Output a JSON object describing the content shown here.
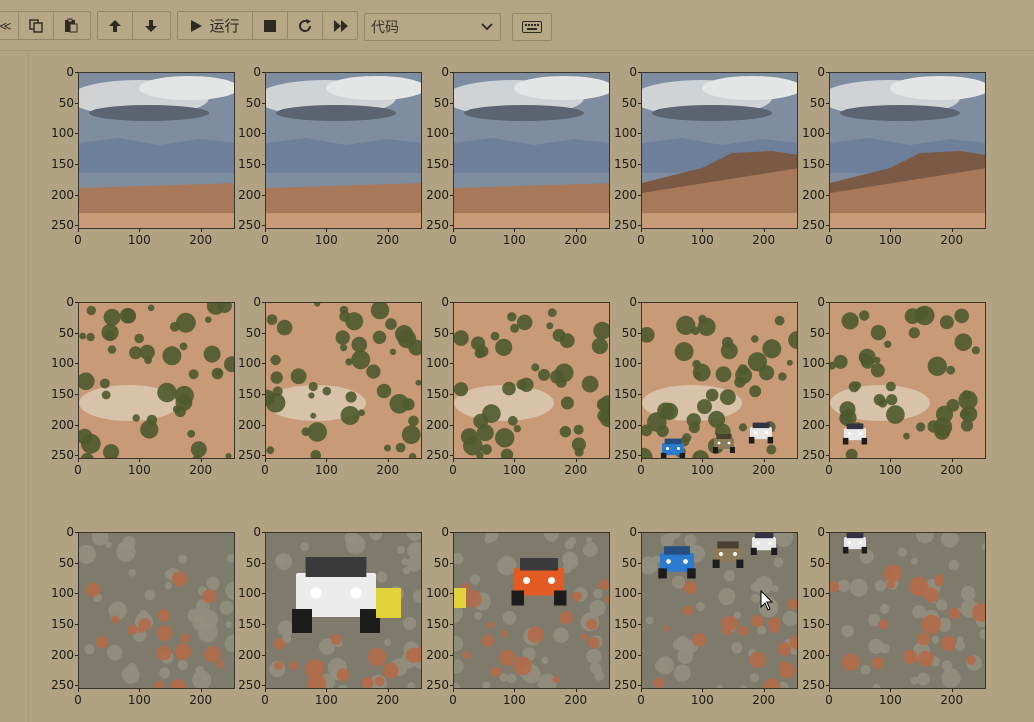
{
  "toolbar": {
    "partial_left": "≪",
    "copy_icon": "copy-icon",
    "paste_icon": "paste-icon",
    "up_icon": "arrow-up-icon",
    "down_icon": "arrow-down-icon",
    "run_label": "运行",
    "stop_icon": "stop-icon",
    "restart_icon": "restart-icon",
    "fast_forward_icon": "fast-forward-icon",
    "cell_type_value": "代码",
    "keyboard_icon": "keyboard-icon"
  },
  "grid": {
    "rows": 3,
    "cols": 5,
    "y_ticks": [
      "0",
      "50",
      "100",
      "150",
      "200",
      "250"
    ],
    "x_ticks": [
      "0",
      "100",
      "200"
    ],
    "panels": [
      {
        "row": 0,
        "col": 0,
        "scene": "sky-landscape"
      },
      {
        "row": 0,
        "col": 1,
        "scene": "sky-landscape"
      },
      {
        "row": 0,
        "col": 2,
        "scene": "sky-landscape"
      },
      {
        "row": 0,
        "col": 3,
        "scene": "sky-mesa"
      },
      {
        "row": 0,
        "col": 4,
        "scene": "sky-mesa"
      },
      {
        "row": 1,
        "col": 0,
        "scene": "desert-shrubs"
      },
      {
        "row": 1,
        "col": 1,
        "scene": "desert-shrubs"
      },
      {
        "row": 1,
        "col": 2,
        "scene": "desert-shrubs"
      },
      {
        "row": 1,
        "col": 3,
        "scene": "desert-jeeps"
      },
      {
        "row": 1,
        "col": 4,
        "scene": "desert-jeep"
      },
      {
        "row": 2,
        "col": 0,
        "scene": "sagebrush"
      },
      {
        "row": 2,
        "col": 1,
        "scene": "white-jeep"
      },
      {
        "row": 2,
        "col": 2,
        "scene": "orange-jeep"
      },
      {
        "row": 2,
        "col": 3,
        "scene": "jeep-convoy"
      },
      {
        "row": 2,
        "col": 4,
        "scene": "sagebrush-jeep"
      }
    ]
  },
  "colors": {
    "background": "#b0a282",
    "sky": "#7e8ea0",
    "cloud": "#cfd3d6",
    "mountain": "#6e7f9a",
    "ground": "#a8785a",
    "sand": "#c99a78",
    "shrub": "#4e5a2e",
    "sage": "#7e7a6c"
  }
}
